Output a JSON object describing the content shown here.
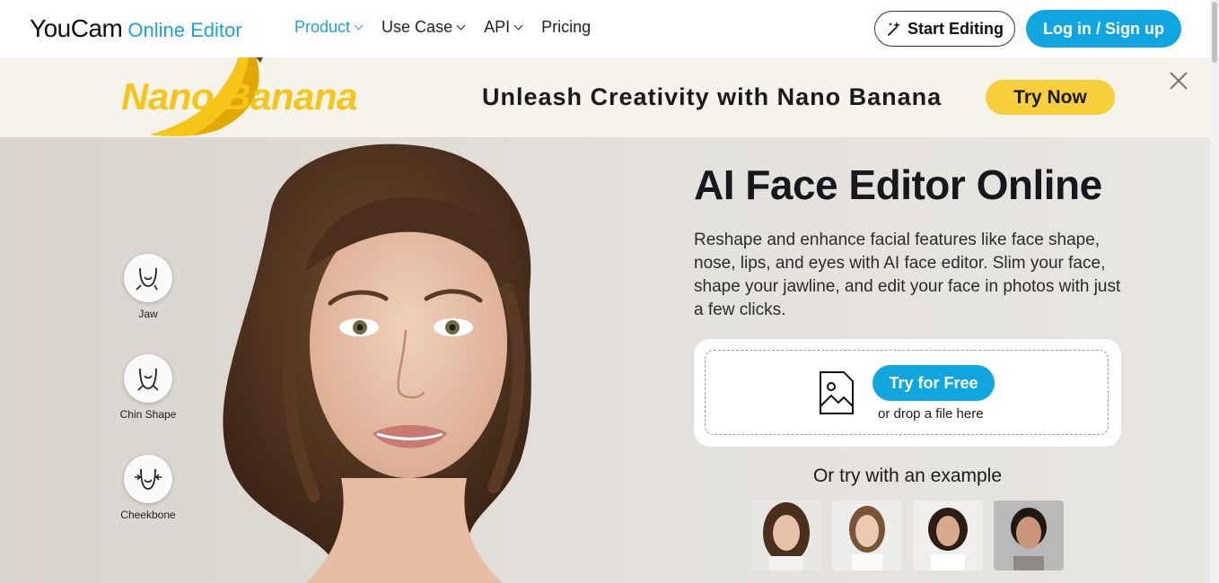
{
  "header": {
    "logo_main": "YouCam",
    "logo_sub": "Online Editor",
    "nav": [
      {
        "label": "Product",
        "active": true
      },
      {
        "label": "Use Case",
        "active": false
      },
      {
        "label": "API",
        "active": false
      },
      {
        "label": "Pricing",
        "active": false
      }
    ],
    "start_editing": "Start Editing",
    "login": "Log in / Sign up"
  },
  "banner": {
    "logo_text": "Nano Banana",
    "headline": "Unleash Creativity with Nano Banana",
    "cta": "Try Now"
  },
  "hero": {
    "features": [
      {
        "label": "Jaw",
        "icon": "jaw-icon"
      },
      {
        "label": "Chin Shape",
        "icon": "chin-shape-icon"
      },
      {
        "label": "Cheekbone",
        "icon": "cheekbone-icon"
      }
    ],
    "title": "AI Face Editor Online",
    "description": "Reshape and enhance facial features like face shape, nose, lips, and eyes with AI face editor. Slim your face, shape your jawline, and edit your face in photos with just a few clicks.",
    "upload": {
      "button": "Try for Free",
      "drop_text": "or drop a file here"
    },
    "examples_title": "Or try with an example"
  },
  "colors": {
    "accent": "#12a6e0",
    "banana_yellow": "#f7cf3a",
    "banner_bg": "#f6f3ea"
  }
}
